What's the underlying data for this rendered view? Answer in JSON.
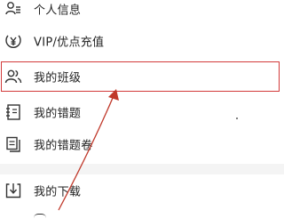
{
  "menu": {
    "items": [
      {
        "label": "个人信息",
        "icon": "person-list-icon"
      },
      {
        "label": "VIP/优点充值",
        "icon": "yen-coin-icon"
      },
      {
        "label": "我的班级",
        "icon": "people-icon"
      },
      {
        "label": "我的错题",
        "icon": "notebook-icon"
      },
      {
        "label": "我的错题卷",
        "icon": "documents-icon"
      },
      {
        "label": "我的下载",
        "icon": "download-icon"
      }
    ]
  },
  "colors": {
    "highlight": "#d23a3a",
    "arrow": "#c0392b",
    "text": "#222222"
  }
}
